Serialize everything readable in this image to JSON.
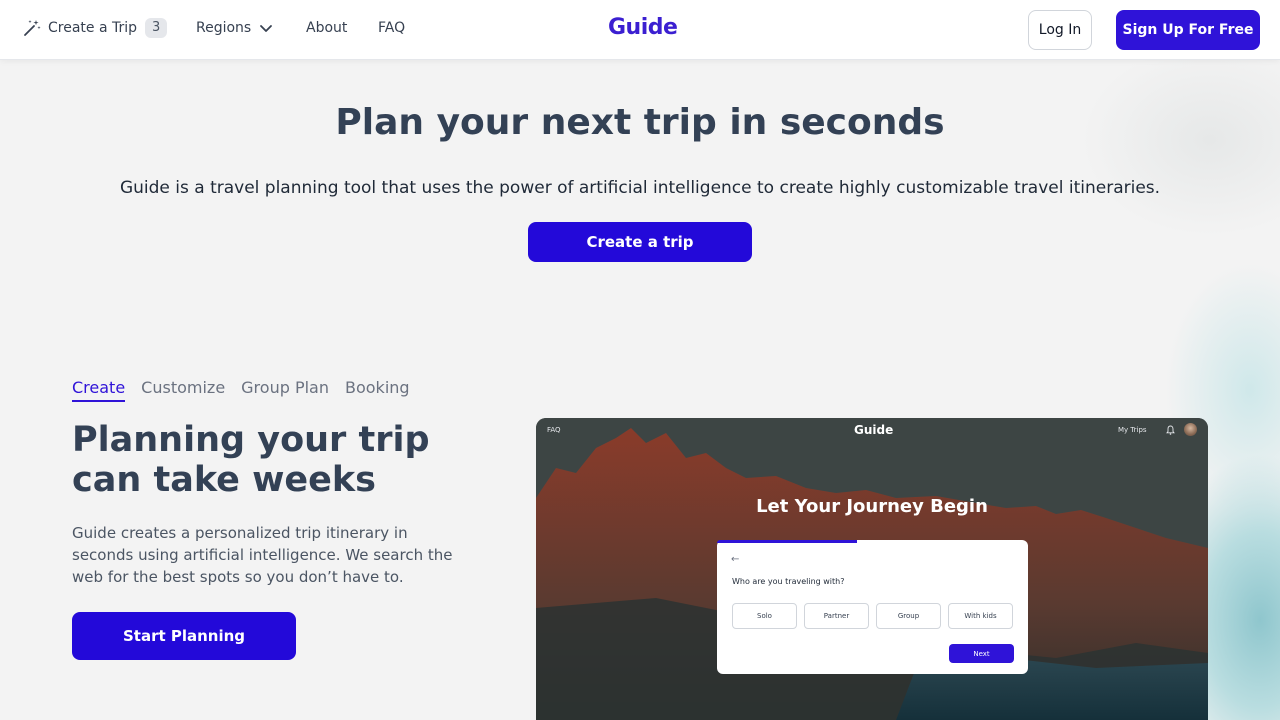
{
  "nav": {
    "create_label": "Create a Trip",
    "create_count": "3",
    "regions_label": "Regions",
    "about_label": "About",
    "faq_label": "FAQ",
    "logo": "Guide",
    "login_label": "Log In",
    "signup_label": "Sign Up For Free"
  },
  "hero": {
    "title_plain": "Plan your next trip ",
    "title_bold": "in seconds",
    "subtitle": "Guide is a travel planning tool that uses the power of artificial intelligence to create highly customizable travel itineraries.",
    "button_label": "Create a trip"
  },
  "features": {
    "tabs": [
      "Create",
      "Customize",
      "Group Plan",
      "Booking"
    ],
    "active_tab": "Create",
    "title": "Planning your trip can take weeks",
    "description": "Guide creates a personalized trip itinerary in seconds using artificial intelligence. We search the web for the best spots so you don’t have to.",
    "button_label": "Start Planning"
  },
  "mockup": {
    "faq_label": "FAQ",
    "logo": "Guide",
    "trips_label": "My Trips",
    "heading": "Let Your Journey Begin",
    "question": "Who are you traveling with?",
    "options": [
      "Solo",
      "Partner",
      "Group",
      "With kids"
    ],
    "next_label": "Next"
  },
  "colors": {
    "brand": "#2f13d8",
    "text": "#334155"
  }
}
